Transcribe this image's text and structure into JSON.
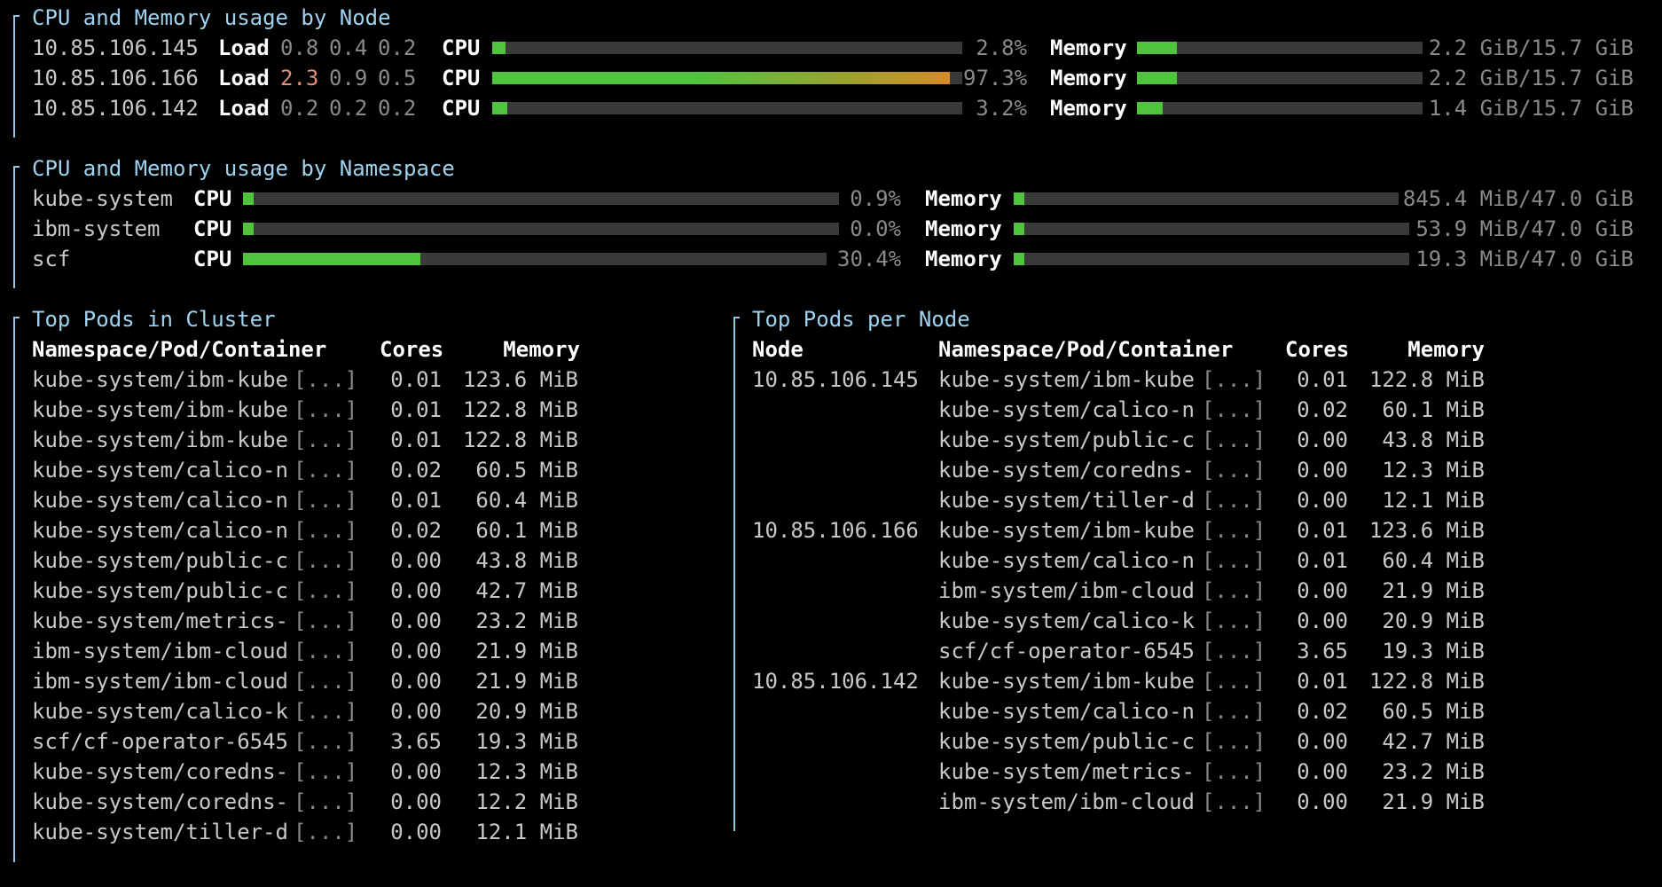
{
  "colors": {
    "accent": "#9fd2ee",
    "bar_track": "#3a3a3a",
    "bar_fill": "#4fc43c",
    "bar_hot": "#d38a28",
    "load_high": "#e0907a"
  },
  "labels": {
    "load": "Load",
    "cpu": "CPU",
    "memory": "Memory",
    "ellipsis": "[...]"
  },
  "nodes_section": {
    "title": "CPU and Memory usage by Node",
    "rows": [
      {
        "ip": "10.85.106.145",
        "load": [
          "0.8",
          "0.4",
          "0.2"
        ],
        "load_high": false,
        "cpu_text": "2.8%",
        "cpu_fraction": 0.028,
        "mem_text": "2.2 GiB/15.7 GiB",
        "mem_fraction": 0.14
      },
      {
        "ip": "10.85.106.166",
        "load": [
          "2.3",
          "0.9",
          "0.5"
        ],
        "load_high": true,
        "cpu_text": "97.3%",
        "cpu_fraction": 0.973,
        "mem_text": "2.2 GiB/15.7 GiB",
        "mem_fraction": 0.14
      },
      {
        "ip": "10.85.106.142",
        "load": [
          "0.2",
          "0.2",
          "0.2"
        ],
        "load_high": false,
        "cpu_text": "3.2%",
        "cpu_fraction": 0.032,
        "mem_text": "1.4 GiB/15.7 GiB",
        "mem_fraction": 0.089
      }
    ]
  },
  "namespaces_section": {
    "title": "CPU and Memory usage by Namespace",
    "rows": [
      {
        "name": "kube-system",
        "cpu_text": "0.9%",
        "cpu_fraction": 0.009,
        "mem_text": "845.4 MiB/47.0 GiB",
        "mem_fraction": 0.018
      },
      {
        "name": "ibm-system",
        "cpu_text": "0.0%",
        "cpu_fraction": 0.0,
        "mem_text": "53.9 MiB/47.0 GiB",
        "mem_fraction": 0.001
      },
      {
        "name": "scf",
        "cpu_text": "30.4%",
        "cpu_fraction": 0.304,
        "mem_text": "19.3 MiB/47.0 GiB",
        "mem_fraction": 0.0004
      }
    ]
  },
  "top_pods_cluster": {
    "title": "Top Pods in Cluster",
    "headers": {
      "pod": "Namespace/Pod/Container",
      "cores": "Cores",
      "memory": "Memory"
    },
    "rows": [
      {
        "pod": "kube-system/ibm-kube",
        "cores": "0.01",
        "memory": "123.6 MiB"
      },
      {
        "pod": "kube-system/ibm-kube",
        "cores": "0.01",
        "memory": "122.8 MiB"
      },
      {
        "pod": "kube-system/ibm-kube",
        "cores": "0.01",
        "memory": "122.8 MiB"
      },
      {
        "pod": "kube-system/calico-n",
        "cores": "0.02",
        "memory": "60.5 MiB"
      },
      {
        "pod": "kube-system/calico-n",
        "cores": "0.01",
        "memory": "60.4 MiB"
      },
      {
        "pod": "kube-system/calico-n",
        "cores": "0.02",
        "memory": "60.1 MiB"
      },
      {
        "pod": "kube-system/public-c",
        "cores": "0.00",
        "memory": "43.8 MiB"
      },
      {
        "pod": "kube-system/public-c",
        "cores": "0.00",
        "memory": "42.7 MiB"
      },
      {
        "pod": "kube-system/metrics-",
        "cores": "0.00",
        "memory": "23.2 MiB"
      },
      {
        "pod": "ibm-system/ibm-cloud",
        "cores": "0.00",
        "memory": "21.9 MiB"
      },
      {
        "pod": "ibm-system/ibm-cloud",
        "cores": "0.00",
        "memory": "21.9 MiB"
      },
      {
        "pod": "kube-system/calico-k",
        "cores": "0.00",
        "memory": "20.9 MiB"
      },
      {
        "pod": "scf/cf-operator-6545",
        "cores": "3.65",
        "memory": "19.3 MiB"
      },
      {
        "pod": "kube-system/coredns-",
        "cores": "0.00",
        "memory": "12.3 MiB"
      },
      {
        "pod": "kube-system/coredns-",
        "cores": "0.00",
        "memory": "12.2 MiB"
      },
      {
        "pod": "kube-system/tiller-d",
        "cores": "0.00",
        "memory": "12.1 MiB"
      }
    ]
  },
  "top_pods_node": {
    "title": "Top Pods per Node",
    "headers": {
      "node": "Node",
      "pod": "Namespace/Pod/Container",
      "cores": "Cores",
      "memory": "Memory"
    },
    "rows": [
      {
        "node": "10.85.106.145",
        "pod": "kube-system/ibm-kube",
        "cores": "0.01",
        "memory": "122.8 MiB"
      },
      {
        "node": "",
        "pod": "kube-system/calico-n",
        "cores": "0.02",
        "memory": "60.1 MiB"
      },
      {
        "node": "",
        "pod": "kube-system/public-c",
        "cores": "0.00",
        "memory": "43.8 MiB"
      },
      {
        "node": "",
        "pod": "kube-system/coredns-",
        "cores": "0.00",
        "memory": "12.3 MiB"
      },
      {
        "node": "",
        "pod": "kube-system/tiller-d",
        "cores": "0.00",
        "memory": "12.1 MiB"
      },
      {
        "node": "10.85.106.166",
        "pod": "kube-system/ibm-kube",
        "cores": "0.01",
        "memory": "123.6 MiB"
      },
      {
        "node": "",
        "pod": "kube-system/calico-n",
        "cores": "0.01",
        "memory": "60.4 MiB"
      },
      {
        "node": "",
        "pod": "ibm-system/ibm-cloud",
        "cores": "0.00",
        "memory": "21.9 MiB"
      },
      {
        "node": "",
        "pod": "kube-system/calico-k",
        "cores": "0.00",
        "memory": "20.9 MiB"
      },
      {
        "node": "",
        "pod": "scf/cf-operator-6545",
        "cores": "3.65",
        "memory": "19.3 MiB"
      },
      {
        "node": "10.85.106.142",
        "pod": "kube-system/ibm-kube",
        "cores": "0.01",
        "memory": "122.8 MiB"
      },
      {
        "node": "",
        "pod": "kube-system/calico-n",
        "cores": "0.02",
        "memory": "60.5 MiB"
      },
      {
        "node": "",
        "pod": "kube-system/public-c",
        "cores": "0.00",
        "memory": "42.7 MiB"
      },
      {
        "node": "",
        "pod": "kube-system/metrics-",
        "cores": "0.00",
        "memory": "23.2 MiB"
      },
      {
        "node": "",
        "pod": "ibm-system/ibm-cloud",
        "cores": "0.00",
        "memory": "21.9 MiB"
      }
    ]
  }
}
